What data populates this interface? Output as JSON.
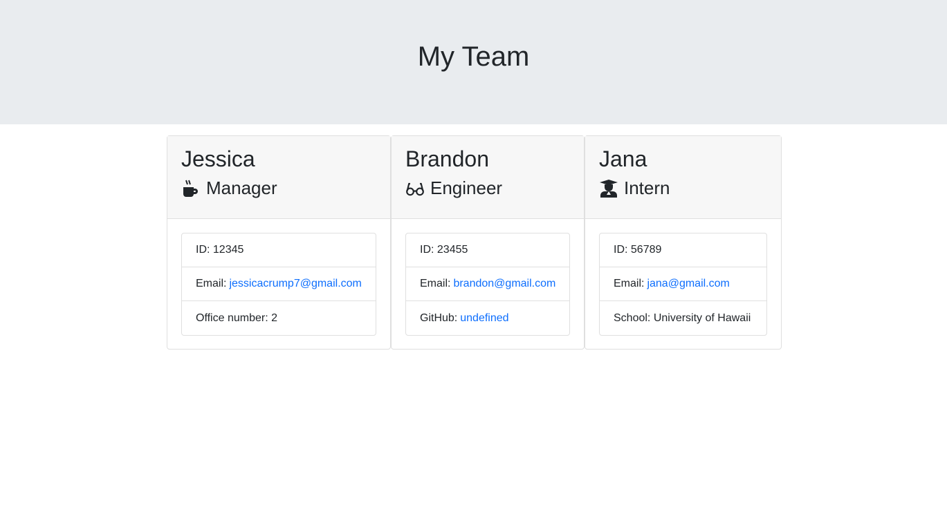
{
  "header": {
    "title": "My Team"
  },
  "colors": {
    "link": "#0d6efd",
    "jumbotron": "#e9ecef"
  },
  "team": [
    {
      "name": "Jessica",
      "role": "Manager",
      "icon": "mug-hot-icon",
      "id_label": "ID: 12345",
      "email_label": "Email:",
      "email": "jessicacrump7@gmail.com",
      "extra_label": "Office number: 2"
    },
    {
      "name": "Brandon",
      "role": "Engineer",
      "icon": "glasses-icon",
      "id_label": "ID: 23455",
      "email_label": "Email:",
      "email": "brandon@gmail.com",
      "extra_label": "GitHub:",
      "extra_link": "undefined"
    },
    {
      "name": "Jana",
      "role": "Intern",
      "icon": "user-graduate-icon",
      "id_label": "ID: 56789",
      "email_label": "Email:",
      "email": "jana@gmail.com",
      "extra_label": "School: University of Hawaii"
    }
  ]
}
